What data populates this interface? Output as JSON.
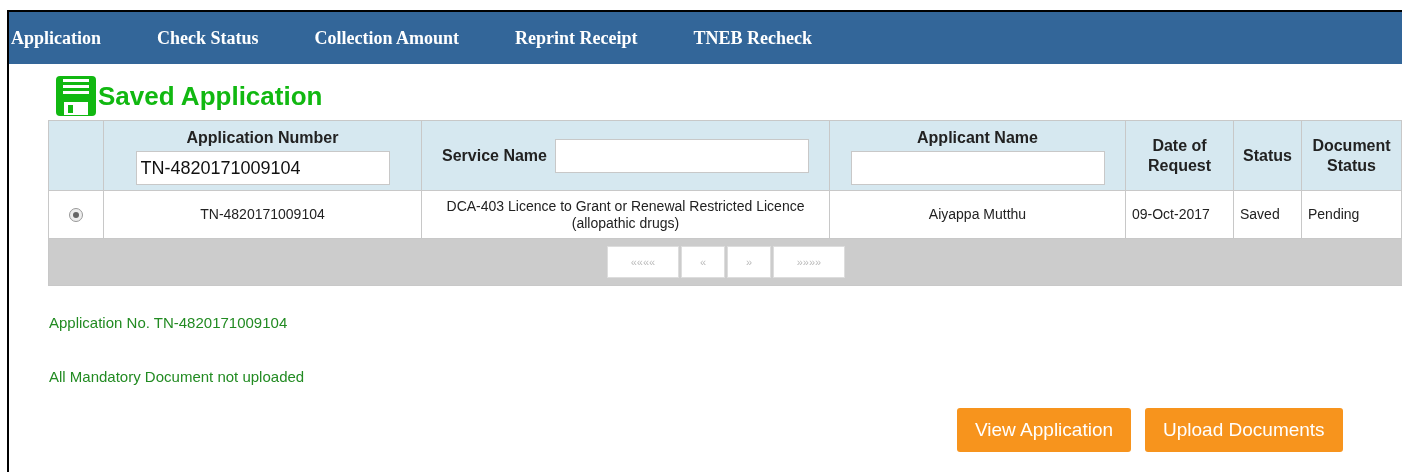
{
  "nav": [
    {
      "label": "Application"
    },
    {
      "label": "Check Status"
    },
    {
      "label": "Collection Amount"
    },
    {
      "label": "Reprint Receipt"
    },
    {
      "label": "TNEB Recheck"
    }
  ],
  "heading": "Saved Application",
  "table": {
    "columns": [
      {
        "kind": "input",
        "label": "Application Number",
        "value": "TN-4820171009104"
      },
      {
        "kind": "inline",
        "label": "Service Name"
      },
      {
        "kind": "input",
        "label": "Applicant Name"
      },
      {
        "kind": "plain",
        "label": "Date of Request"
      },
      {
        "kind": "plain",
        "label": "Status"
      },
      {
        "kind": "plain",
        "label": "Document Status"
      }
    ],
    "rows": [
      {
        "selected": true,
        "cells": [
          "TN-4820171009104",
          "DCA-403 Licence to Grant or Renewal Restricted Licence (allopathic drugs)",
          "Aiyappa Mutthu",
          "09-Oct-2017",
          "Saved",
          "Pending"
        ]
      }
    ],
    "pager": [
      "««««",
      "«",
      "»",
      "»»»»"
    ]
  },
  "messages": [
    "Application No. TN-4820171009104",
    "All Mandatory Document not uploaded"
  ],
  "buttons": [
    "View Application",
    "Upload Documents"
  ]
}
